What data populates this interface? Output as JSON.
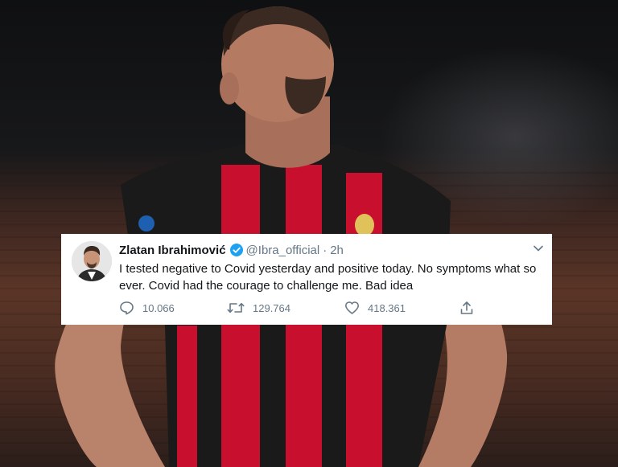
{
  "tweet": {
    "author_name": "Zlatan Ibrahimović",
    "handle": "@Ibra_official",
    "separator": "·",
    "time": "2h",
    "text": "I tested negative to Covid yesterday and positive today. No symptoms what so ever. Covid had the courage to challenge me. Bad idea",
    "verified": true,
    "actions": {
      "replies": "10.066",
      "retweets": "129.764",
      "likes": "418.361"
    }
  },
  "colors": {
    "twitter_blue": "#1da1f2",
    "action_gray": "#657786",
    "milan_red": "#c8102e"
  },
  "icons": [
    "verified-badge-icon",
    "chevron-down-icon",
    "reply-icon",
    "retweet-icon",
    "like-icon",
    "share-icon"
  ]
}
